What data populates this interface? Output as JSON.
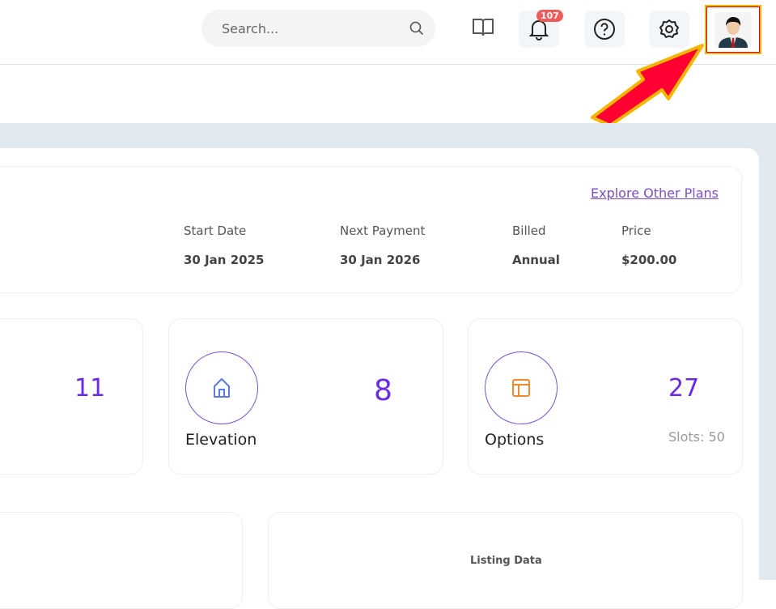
{
  "header": {
    "search_placeholder": "Search...",
    "notification_count": "107"
  },
  "plan": {
    "explore_link": "Explore Other Plans",
    "fields": [
      {
        "label": "Start Date",
        "value": "30 Jan 2025"
      },
      {
        "label": "Next Payment",
        "value": "30 Jan 2026"
      },
      {
        "label": "Billed",
        "value": "Annual"
      },
      {
        "label": "Price",
        "value": "$200.00"
      }
    ]
  },
  "stats": [
    {
      "value": "11"
    },
    {
      "label": "Elevation",
      "value": "8"
    },
    {
      "label": "Options",
      "value": "27",
      "slots": "Slots: 50"
    }
  ],
  "charts": {
    "listing_title": "Listing Data"
  },
  "colors": {
    "accent": "#6a2be8",
    "badge": "#f05a5a",
    "link": "#7a4ec9"
  }
}
